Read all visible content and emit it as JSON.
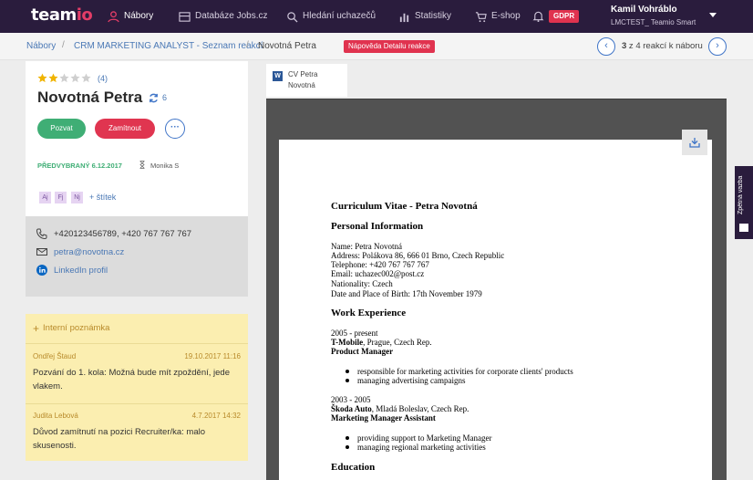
{
  "app": {
    "logo_main": "team",
    "logo_accent": "io",
    "nav": [
      {
        "label": "Nábory",
        "icon": "recruitment-icon",
        "active": true
      },
      {
        "label": "Databáze Jobs.cz",
        "icon": "database-icon",
        "active": false
      },
      {
        "label": "Hledání uchazečů",
        "icon": "search-icon",
        "active": false
      },
      {
        "label": "Statistiky",
        "icon": "chart-icon",
        "active": false
      },
      {
        "label": "E-shop",
        "icon": "cart-icon",
        "active": false
      }
    ],
    "gdpr_label": "GDPR",
    "user": {
      "name": "Kamil Vohráblo",
      "company": "LMCTEST_ Teamio Smart"
    }
  },
  "breadcrumb": {
    "items": [
      "Nábory",
      "CRM MARKETING ANALYST - Seznam reakcí",
      "Novotná Petra"
    ],
    "separator": "/",
    "help_label": "Nápověda Detailu reakce"
  },
  "pager": {
    "current": "3",
    "text": " z 4 reakcí k náboru",
    "prev_icon": "chevron-left-icon",
    "next_icon": "chevron-right-icon"
  },
  "candidate": {
    "rating": 2,
    "rating_max": 5,
    "rating_count": "(4)",
    "name": "Novotná Petra",
    "reactions_count": "6",
    "invite_label": "Pozvat",
    "reject_label": "Zamítnout",
    "more_label": "···",
    "status": "PŘEDVYBRANÝ 6.12.2017",
    "owner": "Monika S",
    "tags": [
      "Aj",
      "Fj",
      "Nj"
    ],
    "add_tag_label": "+ štítek"
  },
  "contacts": {
    "phone": "+420123456789, +420 767 767 767",
    "email": "petra@novotna.cz",
    "linkedin": "LinkedIn profil"
  },
  "notes": {
    "header": "Interní poznámka",
    "items": [
      {
        "author": "Ondřej Štaud",
        "date": "19.10.2017 11:16",
        "text": "Pozvání do 1. kola: Možná bude mít zpoždění, jede vlakem."
      },
      {
        "author": "Judita Lebová",
        "date": "4.7.2017 14:32",
        "text": "Důvod zamítnutí na pozici Recruiter/ka: malo skusenosti."
      }
    ]
  },
  "document": {
    "tab_name_line1": "CV Petra",
    "tab_name_line2": "Novotná",
    "file_icon_letter": "W",
    "cv": {
      "title": "Curriculum Vitae - Petra Novotná",
      "personal_heading": "Personal Information",
      "personal_lines": [
        "Name: Petra Novotná",
        "Address: Polákova 86, 666 01 Brno, Czech Republic",
        "Telephone: +420 767 767 767",
        "Email: uchazec002@post.cz",
        "Nationality: Czech",
        "Date and Place of Birth: 17th November 1979"
      ],
      "work_heading": "Work Experience",
      "job1": {
        "period": "2005 - present",
        "company": "T-Mobile",
        "location": ", Prague, Czech Rep.",
        "title": "Product Manager",
        "bullets": [
          "responsible for marketing activities for corporate clients' products",
          "managing advertising campaigns"
        ]
      },
      "job2": {
        "period": "2003 - 2005",
        "company": "Škoda Auto",
        "location": ", Mladá Boleslav, Czech Rep.",
        "title": "Marketing Manager Assistant",
        "bullets": [
          "providing support to Marketing Manager",
          "managing regional marketing activities"
        ]
      },
      "education_heading": "Education"
    }
  },
  "feedback_label": "Zpětná vazba"
}
